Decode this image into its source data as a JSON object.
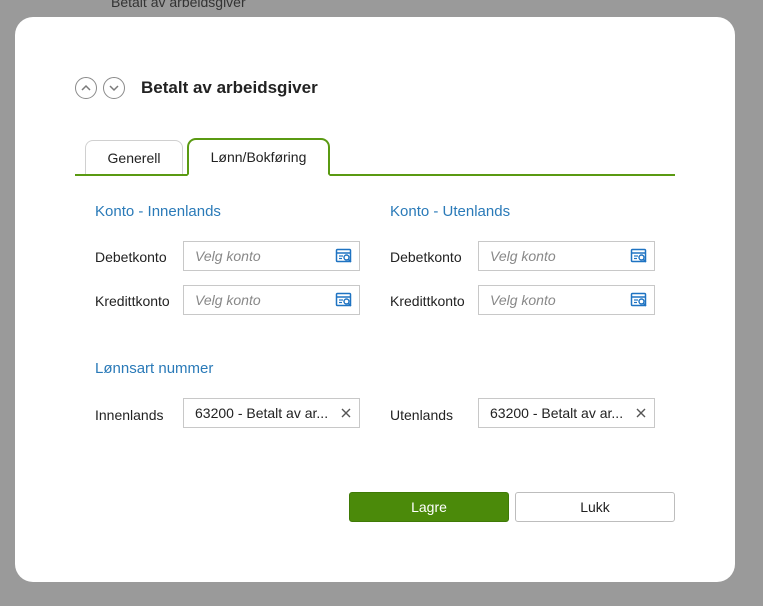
{
  "background": {
    "partial_text": "Betalt av arbeidsgiver"
  },
  "dialog": {
    "title": "Betalt av arbeidsgiver",
    "icons": {
      "prev": "chevron-up-icon",
      "next": "chevron-down-icon"
    }
  },
  "tabs": [
    {
      "label": "Generell",
      "active": false
    },
    {
      "label": "Lønn/Bokføring",
      "active": true
    }
  ],
  "konto_innenlands": {
    "title": "Konto - Innenlands",
    "debet_label": "Debetkonto",
    "debet_placeholder": "Velg konto",
    "kredit_label": "Kredittkonto",
    "kredit_placeholder": "Velg konto"
  },
  "konto_utenlands": {
    "title": "Konto - Utenlands",
    "debet_label": "Debetkonto",
    "debet_placeholder": "Velg konto",
    "kredit_label": "Kredittkonto",
    "kredit_placeholder": "Velg konto"
  },
  "lonnsart": {
    "title": "Lønnsart nummer",
    "innenlands_label": "Innenlands",
    "innenlands_value": "63200 - Betalt av ar...",
    "utenlands_label": "Utenlands",
    "utenlands_value": "63200 - Betalt av ar..."
  },
  "buttons": {
    "save": "Lagre",
    "close": "Lukk"
  },
  "colors": {
    "accent_green": "#4b8a0a",
    "link_blue": "#2a7ab8",
    "lookup_icon_blue": "#1e73c2"
  }
}
